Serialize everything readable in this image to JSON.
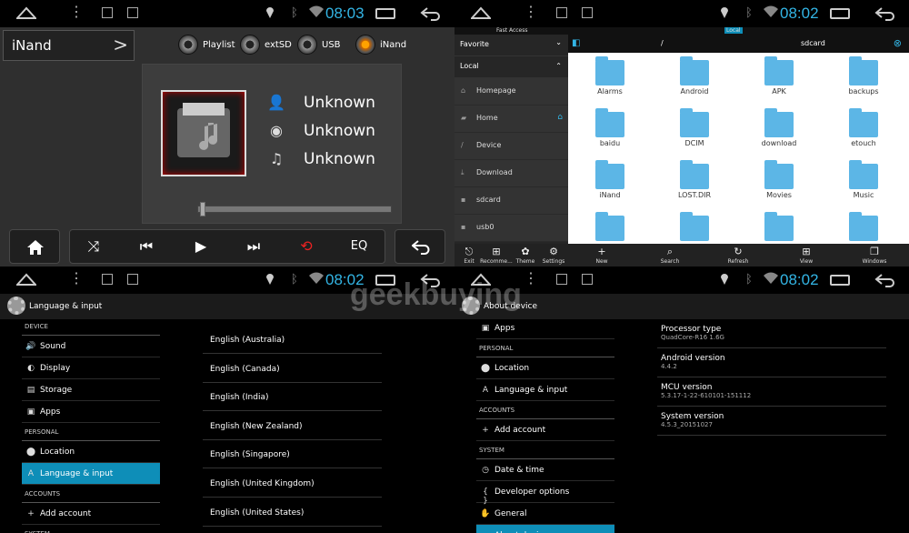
{
  "q1": {
    "time": "08:03",
    "source": "iNand",
    "buttons": [
      "Playlist",
      "extSD",
      "USB",
      "iNand"
    ],
    "artist": "Unknown",
    "album": "Unknown",
    "title": "Unknown",
    "progress": 0.02,
    "eq": "EQ"
  },
  "q2": {
    "time": "08:02",
    "header_left": "Fast Access",
    "header_tab": "Local",
    "sections": {
      "favorite": "Favorite",
      "local": "Local"
    },
    "items": [
      "Homepage",
      "Home",
      "Device",
      "Download",
      "sdcard",
      "usb0"
    ],
    "path_root": "/",
    "path_current": "sdcard",
    "folders": [
      "Alarms",
      "Android",
      "APK",
      "backups",
      "baidu",
      "DCIM",
      "download",
      "etouch",
      "iNand",
      "LOST.DIR",
      "Movies",
      "Music"
    ],
    "left_bar": [
      "Exit",
      "Recomme...",
      "Theme",
      "Settings"
    ],
    "bottom_bar": [
      "New",
      "Search",
      "Refresh",
      "View",
      "Windows"
    ]
  },
  "q3": {
    "time": "08:02",
    "title": "Language & input",
    "list": [
      {
        "type": "hdr",
        "label": "DEVICE"
      },
      {
        "type": "row",
        "label": "Sound",
        "icon": "speaker-icon",
        "glyph": "🔊"
      },
      {
        "type": "row",
        "label": "Display",
        "icon": "display-icon",
        "glyph": "◐"
      },
      {
        "type": "row",
        "label": "Storage",
        "icon": "storage-icon",
        "glyph": "▤"
      },
      {
        "type": "row",
        "label": "Apps",
        "icon": "apps-icon",
        "glyph": "▣"
      },
      {
        "type": "hdr",
        "label": "PERSONAL"
      },
      {
        "type": "row",
        "label": "Location",
        "icon": "location-icon",
        "glyph": "⬤"
      },
      {
        "type": "row",
        "label": "Language & input",
        "icon": "keyboard-icon",
        "glyph": "A",
        "sel": true
      },
      {
        "type": "hdr",
        "label": "ACCOUNTS"
      },
      {
        "type": "row",
        "label": "Add account",
        "icon": "plus-icon",
        "glyph": "+"
      },
      {
        "type": "hdr",
        "label": "SYSTEM"
      }
    ],
    "languages": [
      "English (Australia)",
      "English (Canada)",
      "English (India)",
      "English (New Zealand)",
      "English (Singapore)",
      "English (United Kingdom)",
      "English (United States)"
    ]
  },
  "q4": {
    "time": "08:02",
    "title": "About device",
    "list": [
      {
        "type": "row",
        "label": "Apps",
        "icon": "apps-icon",
        "glyph": "▣"
      },
      {
        "type": "hdr",
        "label": "PERSONAL"
      },
      {
        "type": "row",
        "label": "Location",
        "icon": "location-icon",
        "glyph": "⬤"
      },
      {
        "type": "row",
        "label": "Language & input",
        "icon": "keyboard-icon",
        "glyph": "A"
      },
      {
        "type": "hdr",
        "label": "ACCOUNTS"
      },
      {
        "type": "row",
        "label": "Add account",
        "icon": "plus-icon",
        "glyph": "+"
      },
      {
        "type": "hdr",
        "label": "SYSTEM"
      },
      {
        "type": "row",
        "label": "Date & time",
        "icon": "clock-icon",
        "glyph": "◷"
      },
      {
        "type": "row",
        "label": "Developer options",
        "icon": "braces-icon",
        "glyph": "{ }"
      },
      {
        "type": "row",
        "label": "General",
        "icon": "hand-icon",
        "glyph": "✋"
      },
      {
        "type": "row",
        "label": "About device",
        "icon": "info-icon",
        "glyph": "ⓘ",
        "sel": true
      }
    ],
    "info": [
      {
        "k": "Processor type",
        "v": "QuadCore-R16 1.6G"
      },
      {
        "k": "Android version",
        "v": "4.4.2"
      },
      {
        "k": "MCU version",
        "v": "5.3.17-1-22-610101-151112"
      },
      {
        "k": "System version",
        "v": "4.5.3_20151027"
      }
    ]
  },
  "watermark": "geekbuying"
}
